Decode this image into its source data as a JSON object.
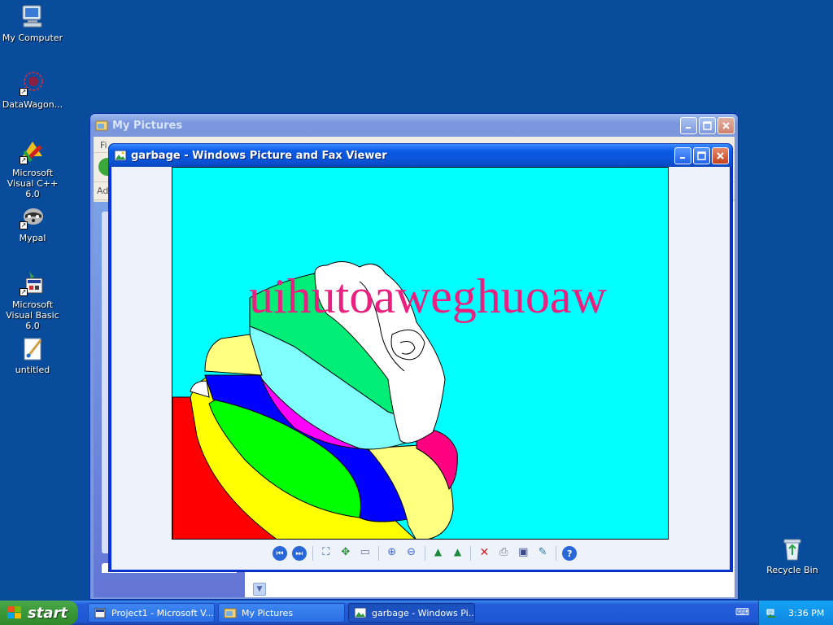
{
  "desktop": {
    "icons": [
      {
        "label": "My Computer"
      },
      {
        "label": "DataWagon..."
      },
      {
        "label": "Microsoft Visual C++ 6.0"
      },
      {
        "label": "Mypal"
      },
      {
        "label": "Microsoft Visual Basic 6.0"
      },
      {
        "label": "untitled"
      },
      {
        "label": "Recycle Bin"
      }
    ]
  },
  "my_pictures_window": {
    "title": "My Pictures",
    "menu_partial": "Fi",
    "address_partial": "Ad"
  },
  "viewer_window": {
    "title": "garbage - Windows Picture and Fax Viewer",
    "image_text": "uihutoaweghuoaw",
    "toolbar_icons": [
      "previous-image-icon",
      "next-image-icon",
      "best-fit-icon",
      "actual-size-icon",
      "slideshow-icon",
      "zoom-in-icon",
      "zoom-out-icon",
      "rotate-clockwise-icon",
      "rotate-counterclockwise-icon",
      "delete-icon",
      "print-icon",
      "save-icon",
      "edit-icon",
      "help-icon"
    ]
  },
  "taskbar": {
    "start_label": "start",
    "tasks": [
      {
        "label": "Project1 - Microsoft V..."
      },
      {
        "label": "My Pictures"
      },
      {
        "label": "garbage - Windows Pi..."
      }
    ],
    "clock": "3:36 PM"
  },
  "colors": {
    "desktop_bg": "#0a4c9c",
    "image_bg": "#00ffff",
    "image_text": "#e8207f"
  }
}
